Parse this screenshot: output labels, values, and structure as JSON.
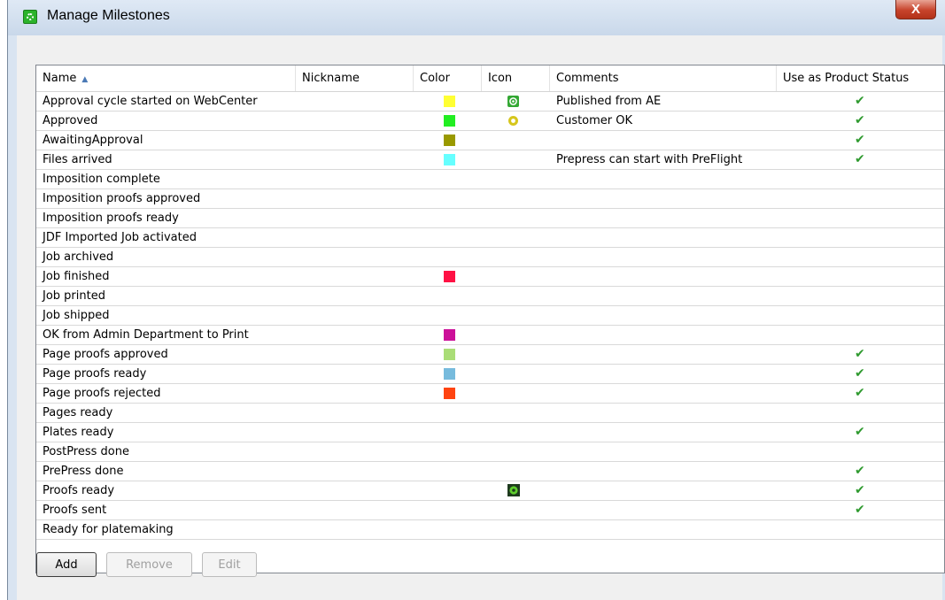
{
  "window": {
    "title": "Manage Milestones",
    "close_label": "X"
  },
  "columns": {
    "name": "Name",
    "nickname": "Nickname",
    "color": "Color",
    "icon": "Icon",
    "comments": "Comments",
    "status": "Use as Product Status"
  },
  "sort_indicator": "▲",
  "check_glyph": "✔",
  "rows": [
    {
      "name": "Approval cycle started on WebCenter",
      "color": "#ffff33",
      "icon": "at-icon",
      "comment": "Published from AE",
      "status": true
    },
    {
      "name": "Approved",
      "color": "#22ee22",
      "icon": "yellow-gear-icon",
      "comment": "Customer OK",
      "status": true
    },
    {
      "name": "AwaitingApproval",
      "color": "#999900",
      "icon": "",
      "comment": "",
      "status": true
    },
    {
      "name": "Files arrived",
      "color": "#66ffff",
      "icon": "",
      "comment": "Prepress can start with PreFlight",
      "status": true
    },
    {
      "name": "Imposition complete",
      "color": "",
      "icon": "",
      "comment": "",
      "status": false
    },
    {
      "name": "Imposition proofs approved",
      "color": "",
      "icon": "",
      "comment": "",
      "status": false
    },
    {
      "name": "Imposition proofs ready",
      "color": "",
      "icon": "",
      "comment": "",
      "status": false
    },
    {
      "name": "JDF Imported Job activated",
      "color": "",
      "icon": "",
      "comment": "",
      "status": false
    },
    {
      "name": "Job archived",
      "color": "",
      "icon": "",
      "comment": "",
      "status": false
    },
    {
      "name": "Job finished",
      "color": "#ff1144",
      "icon": "",
      "comment": "",
      "status": false
    },
    {
      "name": "Job printed",
      "color": "",
      "icon": "",
      "comment": "",
      "status": false
    },
    {
      "name": "Job shipped",
      "color": "",
      "icon": "",
      "comment": "",
      "status": false
    },
    {
      "name": "OK from Admin Department to Print",
      "color": "#cc1199",
      "icon": "",
      "comment": "",
      "status": false
    },
    {
      "name": "Page proofs approved",
      "color": "#aadd77",
      "icon": "",
      "comment": "",
      "status": true
    },
    {
      "name": "Page proofs ready",
      "color": "#77bbdd",
      "icon": "",
      "comment": "",
      "status": true
    },
    {
      "name": "Page proofs rejected",
      "color": "#ff4411",
      "icon": "",
      "comment": "",
      "status": true
    },
    {
      "name": "Pages ready",
      "color": "",
      "icon": "",
      "comment": "",
      "status": false
    },
    {
      "name": "Plates ready",
      "color": "",
      "icon": "",
      "comment": "",
      "status": true
    },
    {
      "name": "PostPress done",
      "color": "",
      "icon": "",
      "comment": "",
      "status": false
    },
    {
      "name": "PrePress done",
      "color": "",
      "icon": "",
      "comment": "",
      "status": true
    },
    {
      "name": "Proofs ready",
      "color": "",
      "icon": "green-gear-icon",
      "comment": "",
      "status": true
    },
    {
      "name": "Proofs sent",
      "color": "",
      "icon": "",
      "comment": "",
      "status": true
    },
    {
      "name": "Ready for platemaking",
      "color": "",
      "icon": "",
      "comment": "",
      "status": false
    }
  ],
  "buttons": {
    "add": "Add",
    "remove": "Remove",
    "edit": "Edit"
  }
}
